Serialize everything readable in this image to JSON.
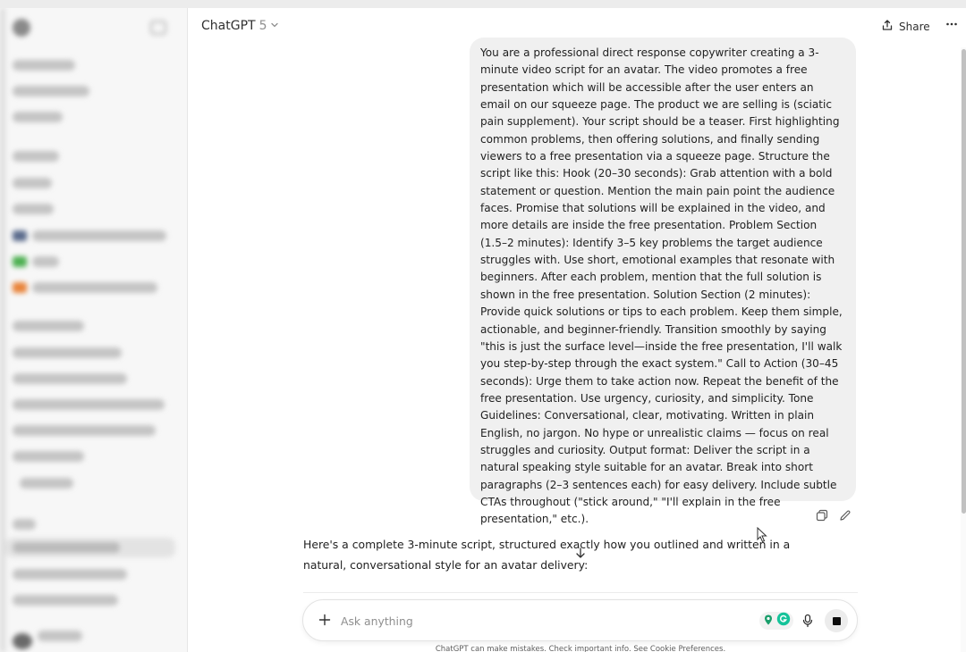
{
  "header": {
    "model_name": "ChatGPT",
    "model_version": "5",
    "share_label": "Share"
  },
  "conversation": {
    "user_message": "You are a professional direct response copywriter creating a 3-minute video script for an avatar. The video promotes a free presentation which will be accessible after the user enters an email on our squeeze page. The product we are selling is (sciatic pain supplement). Your script should be a teaser. First highlighting common problems, then offering solutions, and finally sending viewers to a free presentation via a squeeze page. Structure the script like this: Hook (20–30 seconds): Grab attention with a bold statement or question. Mention the main pain point the audience faces. Promise that solutions will be explained in the video, and more details are inside the free presentation. Problem Section (1.5–2 minutes): Identify 3–5 key problems the target audience struggles with. Use short, emotional examples that resonate with beginners. After each problem, mention that the full solution is shown in the free presentation. Solution Section (2 minutes): Provide quick solutions or tips to each problem. Keep them simple, actionable, and beginner-friendly. Transition smoothly by saying \"this is just the surface level—inside the free presentation, I'll walk you step-by-step through the exact system.\" Call to Action (30–45 seconds): Urge them to take action now. Repeat the benefit of the free presentation. Use urgency, curiosity, and simplicity. Tone Guidelines: Conversational, clear, motivating. Written in plain English, no jargon. No hype or unrealistic claims — focus on real struggles and curiosity. Output format: Deliver the script in a natural speaking style suitable for an avatar. Break into short paragraphs (2–3 sentences each) for easy delivery. Include subtle CTAs throughout (\"stick around,\" \"I'll explain in the free presentation,\" etc.).",
    "assistant_message": "Here's a complete 3-minute script, structured exactly how you outlined and written in a natural, conversational style for an avatar delivery:"
  },
  "composer": {
    "placeholder": "Ask anything"
  },
  "footer": {
    "disclaimer": "ChatGPT can make mistakes. Check important info. See Cookie Preferences."
  },
  "icons": {
    "model_dropdown": "chevron-down-icon",
    "share": "share-icon",
    "more": "more-icon",
    "copy": "copy-icon",
    "edit": "edit-icon",
    "scroll_down": "arrow-down-icon",
    "attach": "plus-icon",
    "voice": "mic-icon",
    "stop": "stop-icon",
    "extensions": [
      "extension-icon",
      "grammarly-icon"
    ]
  },
  "colors": {
    "user_bubble": "#f0f0f0",
    "grammarly_green": "#15c39a",
    "extension_teal": "#1a9e6b"
  }
}
